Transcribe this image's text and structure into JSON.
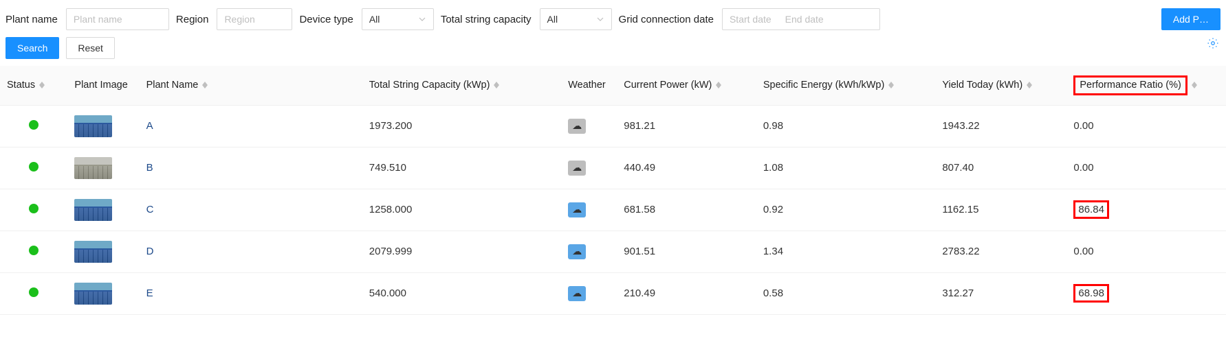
{
  "filters": {
    "plant_name_label": "Plant name",
    "plant_name_placeholder": "Plant name",
    "region_label": "Region",
    "region_placeholder": "Region",
    "device_type_label": "Device type",
    "device_type_value": "All",
    "total_string_capacity_label": "Total string capacity",
    "total_string_capacity_value": "All",
    "grid_connection_date_label": "Grid connection date",
    "start_date_placeholder": "Start date",
    "end_date_placeholder": "End date",
    "add_button": "Add P…"
  },
  "actions": {
    "search_button": "Search",
    "reset_button": "Reset"
  },
  "table": {
    "columns": {
      "status": "Status",
      "plant_image": "Plant Image",
      "plant_name": "Plant Name",
      "total_string_capacity": "Total String Capacity (kWp)",
      "weather": "Weather",
      "current_power": "Current Power (kW)",
      "specific_energy": "Specific Energy (kWh/kWp)",
      "yield_today": "Yield Today (kWh)",
      "performance_ratio": "Performance Ratio (%)"
    },
    "rows": [
      {
        "name": "A",
        "capacity": "1973.200",
        "weather": "cloud-rain",
        "weather_style": "gray",
        "power": "981.21",
        "specific": "0.98",
        "yield": "1943.22",
        "pr": "0.00",
        "pr_highlight": false,
        "thumb": "blue"
      },
      {
        "name": "B",
        "capacity": "749.510",
        "weather": "cloud-rain",
        "weather_style": "gray",
        "power": "440.49",
        "specific": "1.08",
        "yield": "807.40",
        "pr": "0.00",
        "pr_highlight": false,
        "thumb": "gray"
      },
      {
        "name": "C",
        "capacity": "1258.000",
        "weather": "cloud-sun",
        "weather_style": "blue",
        "power": "681.58",
        "specific": "0.92",
        "yield": "1162.15",
        "pr": "86.84",
        "pr_highlight": true,
        "thumb": "blue"
      },
      {
        "name": "D",
        "capacity": "2079.999",
        "weather": "cloud-sun",
        "weather_style": "blue",
        "power": "901.51",
        "specific": "1.34",
        "yield": "2783.22",
        "pr": "0.00",
        "pr_highlight": false,
        "thumb": "blue"
      },
      {
        "name": "E",
        "capacity": "540.000",
        "weather": "cloud-sun",
        "weather_style": "blue",
        "power": "210.49",
        "specific": "0.58",
        "yield": "312.27",
        "pr": "68.98",
        "pr_highlight": true,
        "thumb": "blue"
      }
    ]
  }
}
